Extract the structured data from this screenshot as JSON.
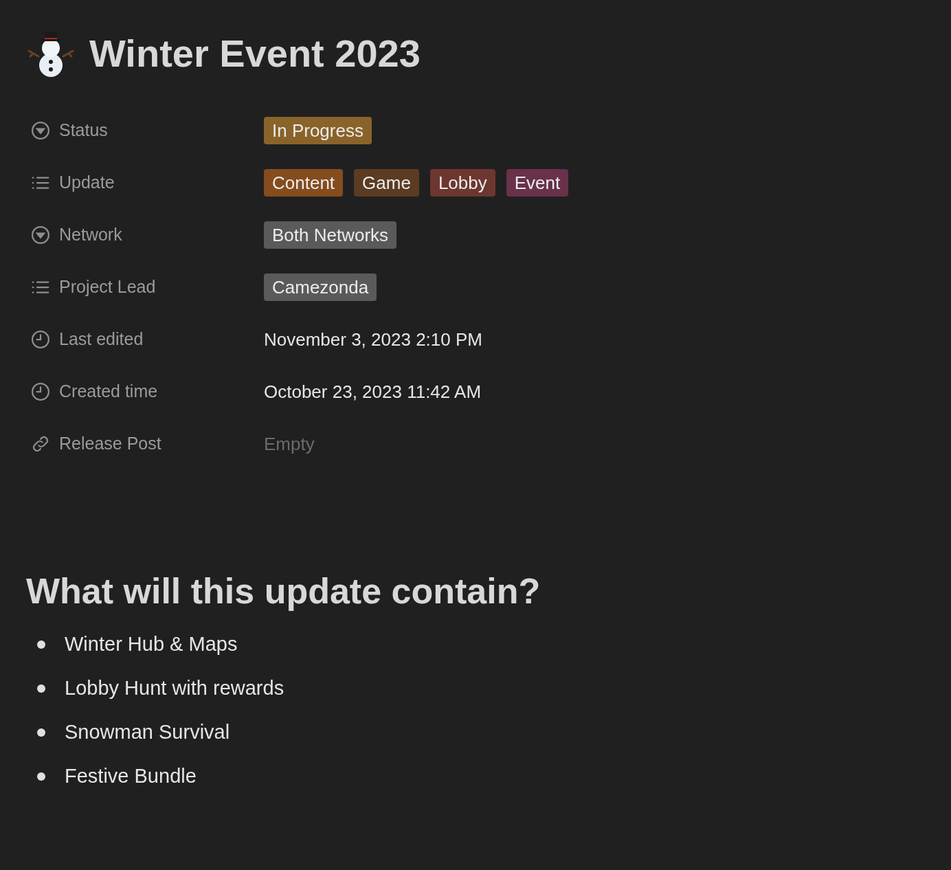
{
  "page": {
    "title": "Winter Event 2023"
  },
  "properties": [
    {
      "kind": "select",
      "label": "Status",
      "tags": [
        {
          "text": "In Progress",
          "color": "#89632a"
        }
      ]
    },
    {
      "kind": "multi_select",
      "label": "Update",
      "tags": [
        {
          "text": "Content",
          "color": "#854c1d"
        },
        {
          "text": "Game",
          "color": "#5c3b23"
        },
        {
          "text": "Lobby",
          "color": "#6e3630"
        },
        {
          "text": "Event",
          "color": "#69314c"
        }
      ]
    },
    {
      "kind": "select",
      "label": "Network",
      "tags": [
        {
          "text": "Both Networks",
          "color": "#5a5a5a"
        }
      ]
    },
    {
      "kind": "multi_select",
      "label": "Project Lead",
      "tags": [
        {
          "text": "Camezonda",
          "color": "#5a5a5a"
        }
      ]
    },
    {
      "kind": "date",
      "label": "Last edited",
      "value": "November 3, 2023 2:10 PM"
    },
    {
      "kind": "date",
      "label": "Created time",
      "value": "October 23, 2023 11:42 AM"
    },
    {
      "kind": "url",
      "label": "Release Post",
      "placeholder": "Empty"
    }
  ],
  "section": {
    "heading": "What will this update contain?",
    "items": [
      "Winter Hub & Maps",
      "Lobby Hunt with rewards",
      "Snowman Survival",
      "Festive Bundle"
    ]
  }
}
